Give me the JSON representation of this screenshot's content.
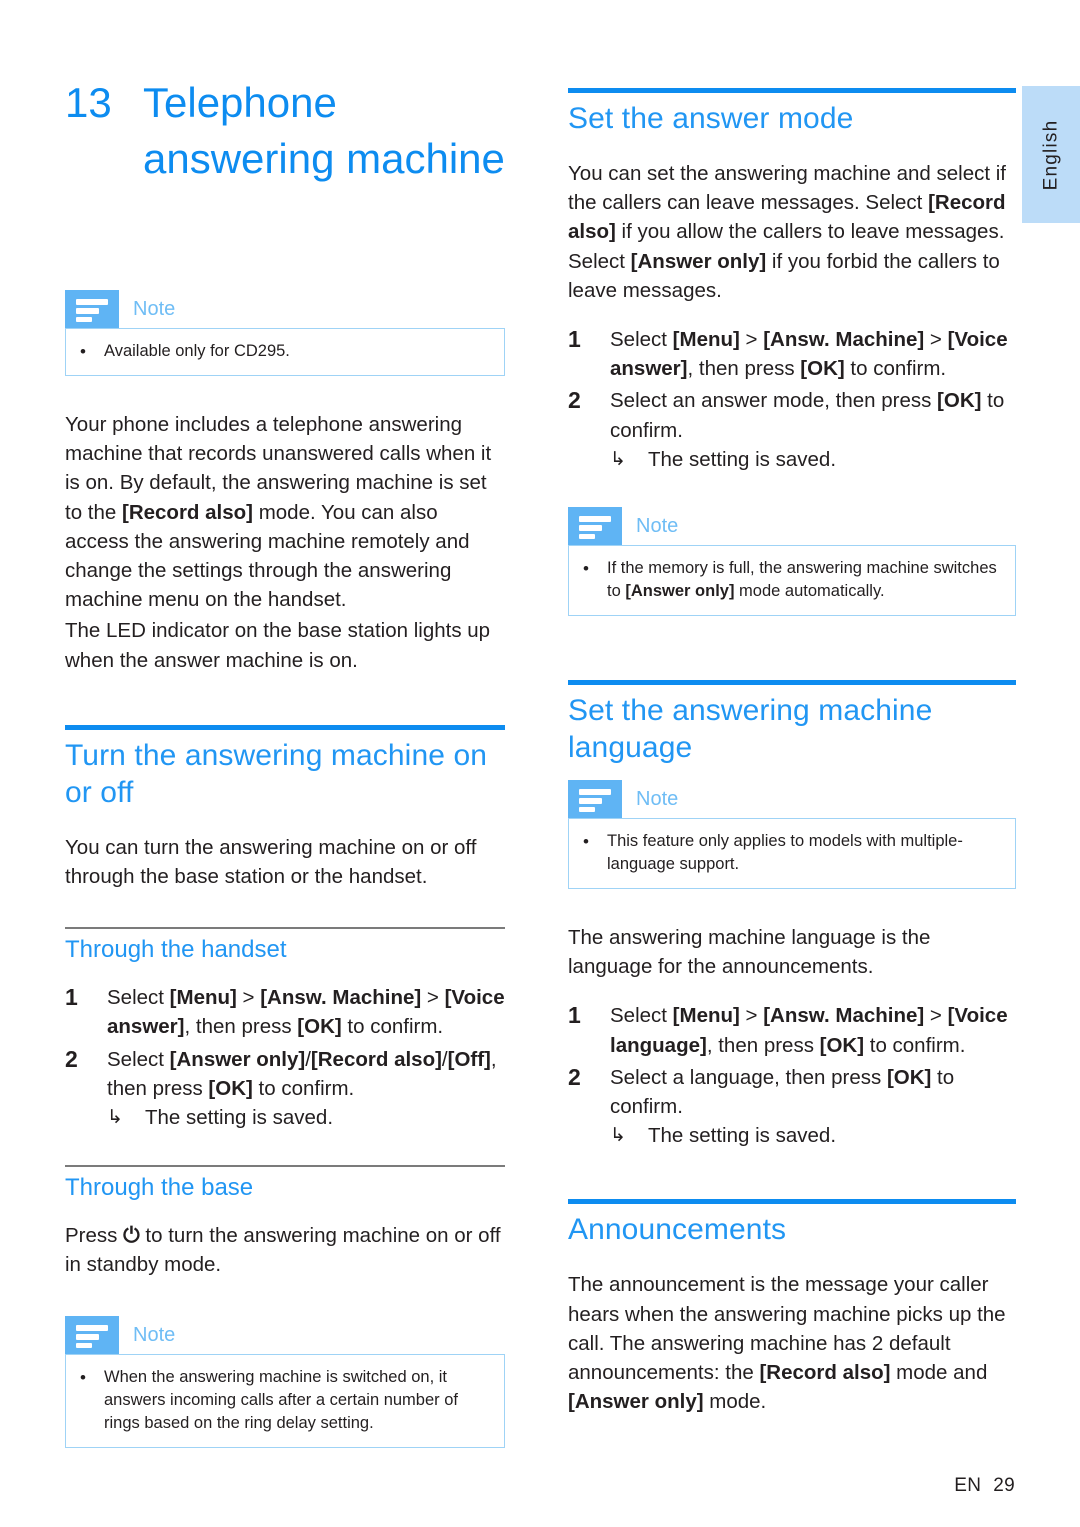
{
  "page": {
    "language_tab": "English",
    "footer_lang": "EN",
    "footer_page": "29",
    "accent_blue": "#0d8cf0",
    "heading_blue": "#2196f3",
    "note_icon_blue": "#5fb4f4",
    "note_border_blue": "#9fd3f6",
    "lang_tab_blue": "#bcdcf8"
  },
  "chapter": {
    "number": "13",
    "title": "Telephone answering machine"
  },
  "note_labels": {
    "label": "Note",
    "bullet": "•"
  },
  "left": {
    "note_cd295": {
      "items": [
        "Available only for CD295."
      ]
    },
    "intro": {
      "p1_a": "Your phone includes a telephone answering machine that records unanswered calls when it is on. By default, the answering machine is set to the ",
      "p1_b": "[Record also]",
      "p1_c": " mode. You can also access the answering machine remotely and change the settings through the answering machine menu on the handset.",
      "p2": "The LED indicator on the base station lights up when the answer machine is on."
    },
    "section_turn": {
      "heading": "Turn the answering machine on or off",
      "intro": "You can turn the answering machine on or off through the base station or the handset.",
      "sub_handset": {
        "heading": "Through the handset",
        "steps": [
          {
            "marker": "1",
            "a": "Select ",
            "b1": "[Menu]",
            "c": " > ",
            "b2": "[Answ. Machine]",
            "d": " > ",
            "b3": "[Voice answer]",
            "e": ", then press ",
            "b4": "[OK]",
            "f": " to confirm."
          },
          {
            "marker": "2",
            "a": "Select ",
            "b1": "[Answer only]",
            "c": "/",
            "b2": "[Record also]",
            "d": "/",
            "b3": "[Off]",
            "e": ", then press ",
            "b4": "[OK]",
            "f": " to confirm.",
            "result_arrow": "↳",
            "result": "The setting is saved."
          }
        ]
      },
      "sub_base": {
        "heading": "Through the base",
        "text_a": "Press ",
        "icon": "⏻",
        "text_b": " to turn the answering machine on or off in standby mode.",
        "note": {
          "items": [
            "When the answering machine is switched on, it answers incoming calls after a certain number of rings based on the ring delay setting."
          ]
        }
      }
    }
  },
  "right": {
    "section_answer_mode": {
      "heading": "Set the answer mode",
      "intro_a": "You can set the answering machine and select if the callers can leave messages. Select ",
      "intro_b1": "[Record also]",
      "intro_c": " if you allow the callers to leave messages. Select ",
      "intro_b2": "[Answer only]",
      "intro_d": " if you forbid the callers to leave messages.",
      "steps": [
        {
          "marker": "1",
          "a": "Select ",
          "b1": "[Menu]",
          "c": " > ",
          "b2": "[Answ. Machine]",
          "d": " > ",
          "b3": "[Voice answer]",
          "e": ", then press ",
          "b4": "[OK]",
          "f": " to confirm."
        },
        {
          "marker": "2",
          "a": "Select an answer mode, then press ",
          "b1": "[OK]",
          "c": " to confirm.",
          "result_arrow": "↳",
          "result": "The setting is saved."
        }
      ],
      "note": {
        "item_a": "If the memory is full, the answering machine switches to ",
        "item_b": "[Answer only]",
        "item_c": " mode automatically."
      }
    },
    "section_language": {
      "heading": "Set the answering machine language",
      "note": {
        "items": [
          "This feature only applies to models with multiple-language support."
        ]
      },
      "intro": "The answering machine language is the language for the announcements.",
      "steps": [
        {
          "marker": "1",
          "a": "Select ",
          "b1": "[Menu]",
          "c": " > ",
          "b2": "[Answ. Machine]",
          "d": " > ",
          "b3": "[Voice language]",
          "e": ", then press ",
          "b4": "[OK]",
          "f": " to confirm."
        },
        {
          "marker": "2",
          "a": "Select a language, then press ",
          "b1": "[OK]",
          "c": " to confirm.",
          "result_arrow": "↳",
          "result": "The setting is saved."
        }
      ]
    },
    "section_announcements": {
      "heading": "Announcements",
      "p_a": "The announcement is the message your caller hears when the answering machine picks up the call. The answering machine has 2 default announcements: the ",
      "p_b1": "[Record also]",
      "p_c": " mode and ",
      "p_b2": "[Answer only]",
      "p_d": " mode."
    }
  }
}
